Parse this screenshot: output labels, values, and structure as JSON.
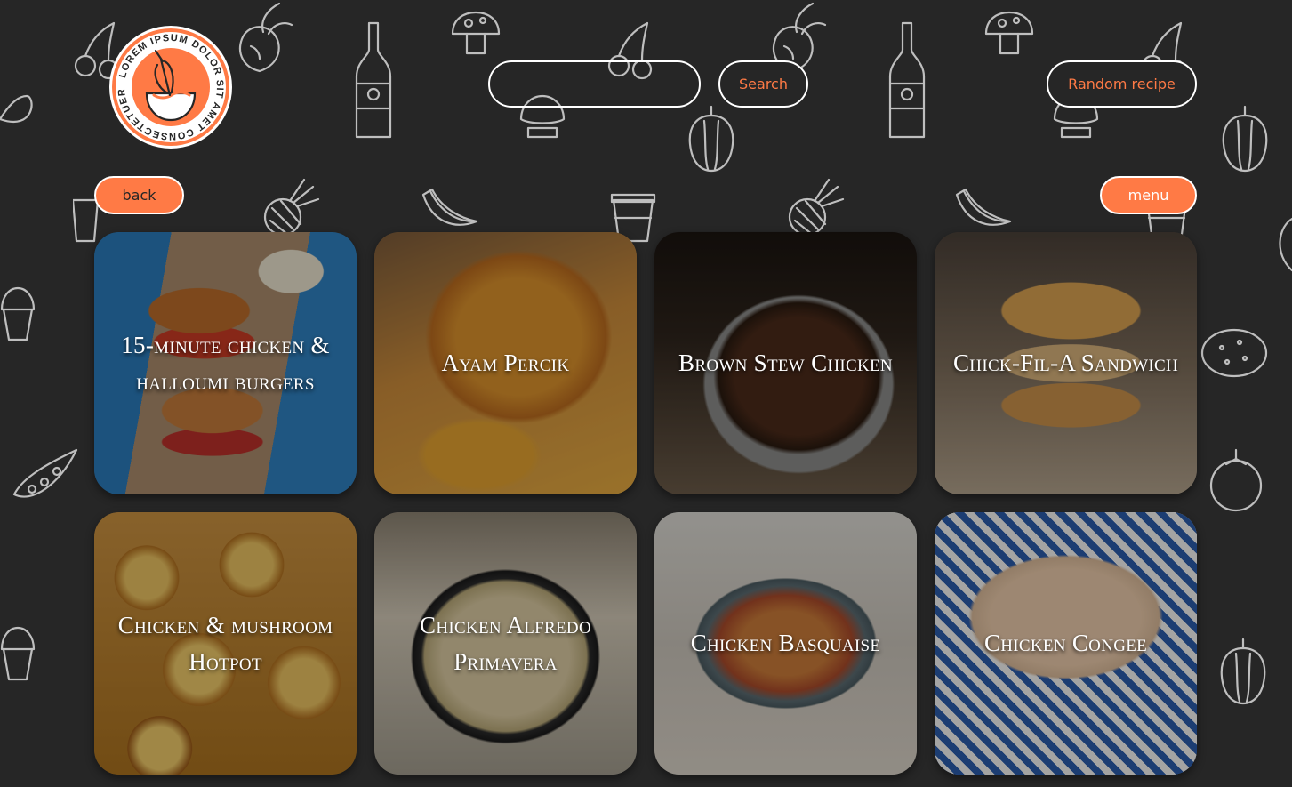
{
  "logo": {
    "ring_text": "LOREM IPSUM DOLOR SIT AMET CONSECTETUER",
    "icon": "whisk-bowl-icon"
  },
  "header": {
    "search": {
      "value": "",
      "placeholder": ""
    },
    "search_button": "Search",
    "random_button": "Random recipe"
  },
  "nav": {
    "back_label": "back",
    "menu_label": "menu"
  },
  "colors": {
    "background": "#262626",
    "accent": "#ff7a45",
    "outline": "#ffffff"
  },
  "recipes": [
    {
      "title": "15-minute chicken & halloumi burgers",
      "photo": "burger-halloumi"
    },
    {
      "title": "Ayam Percik",
      "photo": "ayam-percik"
    },
    {
      "title": "Brown Stew Chicken",
      "photo": "brown-stew"
    },
    {
      "title": "Chick-Fil-A Sandwich",
      "photo": "chick-fil-a"
    },
    {
      "title": "Chicken & mushroom Hotpot",
      "photo": "hotpot"
    },
    {
      "title": "Chicken Alfredo Primavera",
      "photo": "alfredo"
    },
    {
      "title": "Chicken Basquaise",
      "photo": "basquaise"
    },
    {
      "title": "Chicken Congee",
      "photo": "congee"
    }
  ]
}
